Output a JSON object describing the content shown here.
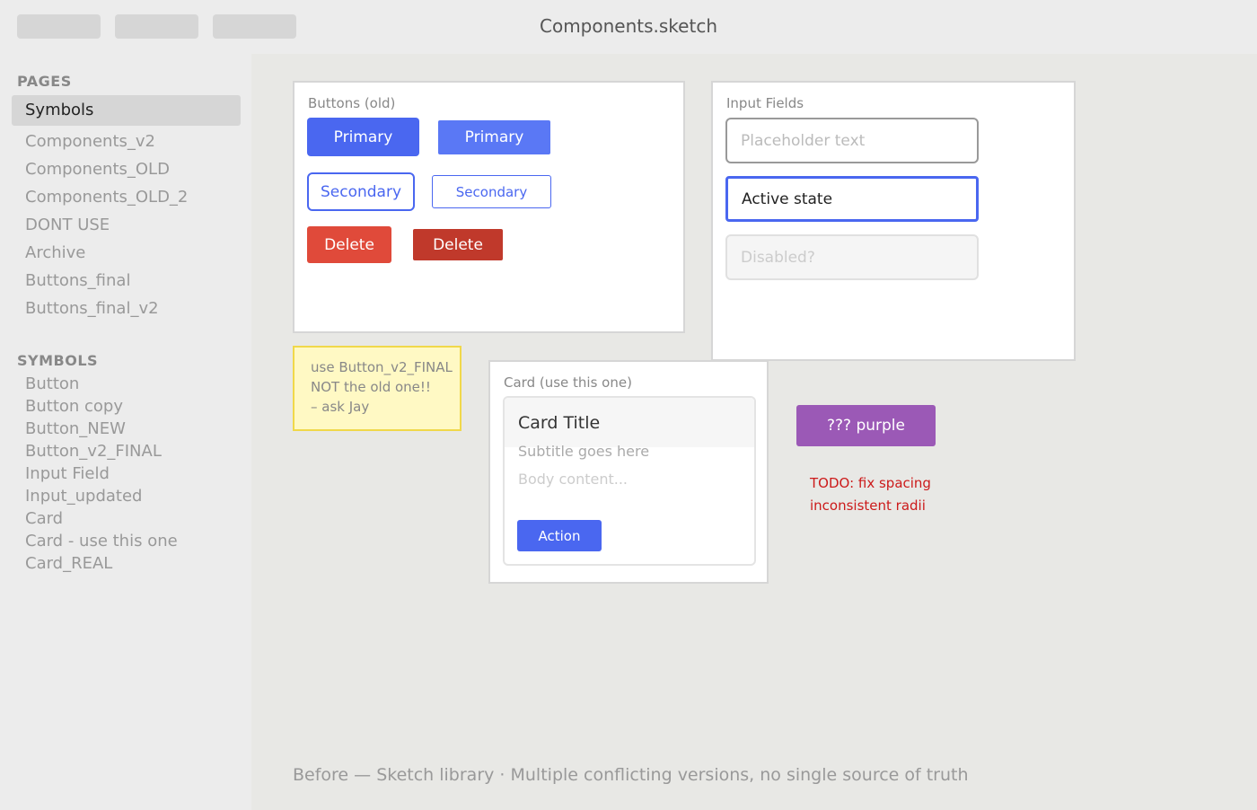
{
  "window": {
    "title": "Components.sketch"
  },
  "sidebar": {
    "pages_heading": "PAGES",
    "pages": [
      {
        "label": "Symbols",
        "selected": true
      },
      {
        "label": "Components_v2"
      },
      {
        "label": "Components_OLD"
      },
      {
        "label": "Components_OLD_2"
      },
      {
        "label": "DONT USE"
      },
      {
        "label": "Archive"
      },
      {
        "label": "Buttons_final"
      },
      {
        "label": "Buttons_final_v2"
      }
    ],
    "symbols_heading": "SYMBOLS",
    "symbols": [
      {
        "label": "Button"
      },
      {
        "label": "Button copy"
      },
      {
        "label": "Button_NEW"
      },
      {
        "label": "Button_v2_FINAL"
      },
      {
        "label": "Input Field"
      },
      {
        "label": "Input_updated"
      },
      {
        "label": "Card"
      },
      {
        "label": "Card - use this one"
      },
      {
        "label": "Card_REAL"
      }
    ]
  },
  "canvas": {
    "buttons_board": {
      "label": "Buttons (old)",
      "primary_1": "Primary",
      "primary_2": "Primary",
      "secondary_1": "Secondary",
      "secondary_2": "Secondary",
      "delete_1": "Delete",
      "delete_2": "Delete"
    },
    "inputs_board": {
      "label": "Input Fields",
      "placeholder_field": "Placeholder text",
      "active_field": "Active state",
      "disabled_field": "Disabled?"
    },
    "sticky_note": {
      "line1": "use Button_v2_FINAL",
      "line2": "NOT the old one!!",
      "line3": "– ask Jay"
    },
    "card_board": {
      "label": "Card (use this one)",
      "title": "Card Title",
      "subtitle": "Subtitle goes here",
      "body": "Body content...",
      "action": "Action"
    },
    "purple_button": "??? purple",
    "todo": {
      "line1": "TODO: fix spacing",
      "line2": "inconsistent radii"
    },
    "caption": "Before — Sketch library · Multiple conflicting versions, no single source of truth"
  },
  "colors": {
    "primary": "#4a67f0",
    "danger": "#e04a3a",
    "danger_dark": "#c0392b",
    "purple": "#9b59b6",
    "todo_red": "#cc1a1a",
    "sticky_yellow": "#fff9c4"
  }
}
